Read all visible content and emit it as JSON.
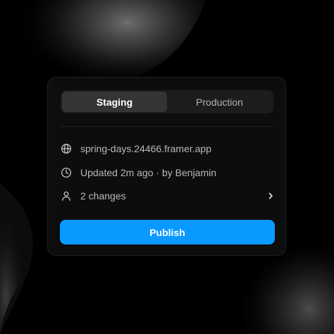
{
  "tabs": [
    {
      "label": "Staging",
      "active": true
    },
    {
      "label": "Production",
      "active": false
    }
  ],
  "info": {
    "domain": {
      "icon": "globe-icon",
      "text": "spring-days.24466.framer.app"
    },
    "updated": {
      "icon": "clock-icon",
      "text": "Updated 2m ago · by Benjamin"
    },
    "changes": {
      "icon": "user-icon",
      "text": "2 changes",
      "chevron": "chevron-right-icon"
    }
  },
  "publish_label": "Publish",
  "colors": {
    "accent": "#0A99FF",
    "panel": "#0D0D0E",
    "tab_active": "#343436",
    "text_muted": "#B9B9BC"
  }
}
